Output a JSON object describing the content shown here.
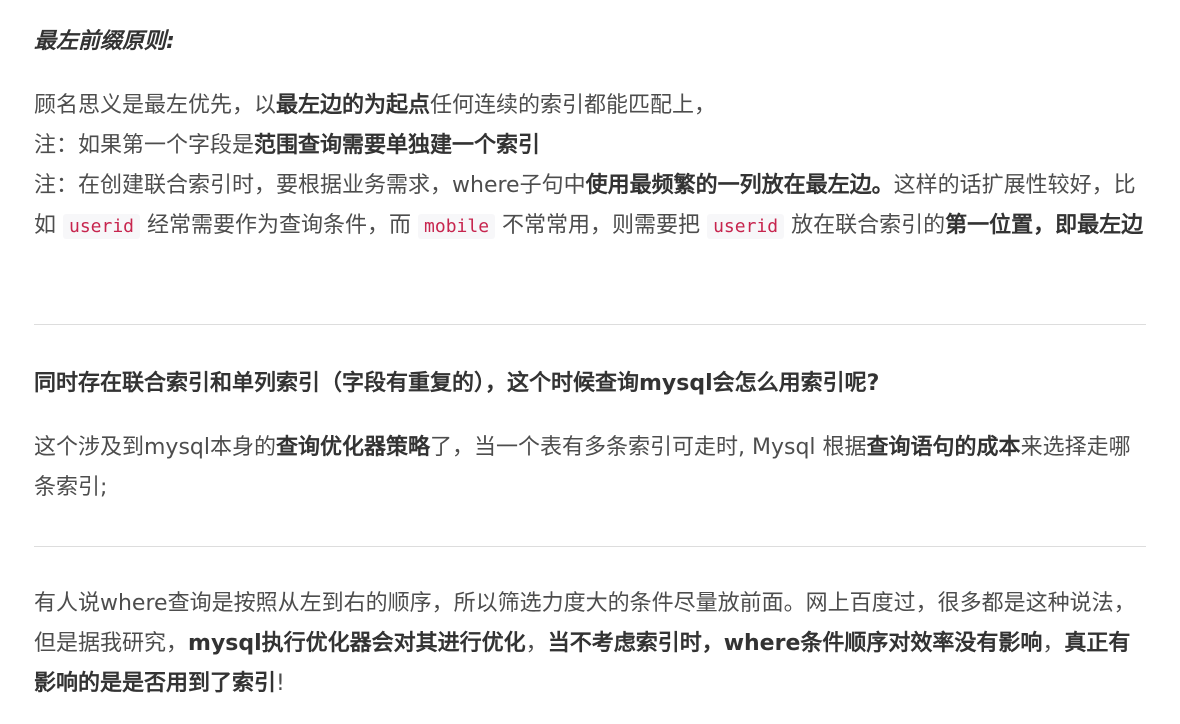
{
  "section1": {
    "title": "最左前缀原则:",
    "p1": {
      "a": "顾名思义是最左优先，以",
      "b_bold": "最左边的为起点",
      "c": "任何连续的索引都能匹配上，"
    },
    "p2": {
      "a": "注：如果第一个字段是",
      "b_bold": "范围查询需要单独建一个索引"
    },
    "p3": {
      "a": "注：在创建联合索引时，要根据业务需求，where子句中",
      "b_bold": "使用最频繁的一列放在最左边。",
      "c": "这样的话扩展性较好，比如 ",
      "code1": "userid",
      "d": " 经常需要作为查询条件，而 ",
      "code2": "mobile",
      "e": " 不常常用，则需要把 ",
      "code3": "userid",
      "f": " 放在联合索引的",
      "g_bold": "第一位置，即最左边"
    }
  },
  "section2": {
    "question": "同时存在联合索引和单列索引（字段有重复的），这个时候查询mysql会怎么用索引呢?",
    "answer": {
      "a": "这个涉及到mysql本身的",
      "b_bold": "查询优化器策略",
      "c": "了，当一个表有多条索引可走时, Mysql 根据",
      "d_bold": "查询语句的成本",
      "e": "来选择走哪条索引;"
    }
  },
  "section3": {
    "a": "有人说where查询是按照从左到右的顺序，所以筛选力度大的条件尽量放前面。网上百度过，很多都是这种说法，但是据我研究，",
    "b_bold": "mysql执行优化器会对其进行优化",
    "c": "，",
    "d_bold": "当不考虑索引时，where条件顺序对效率没有影响",
    "e": "，",
    "f_bold": "真正有影响的是是否用到了索引",
    "g": "!"
  }
}
